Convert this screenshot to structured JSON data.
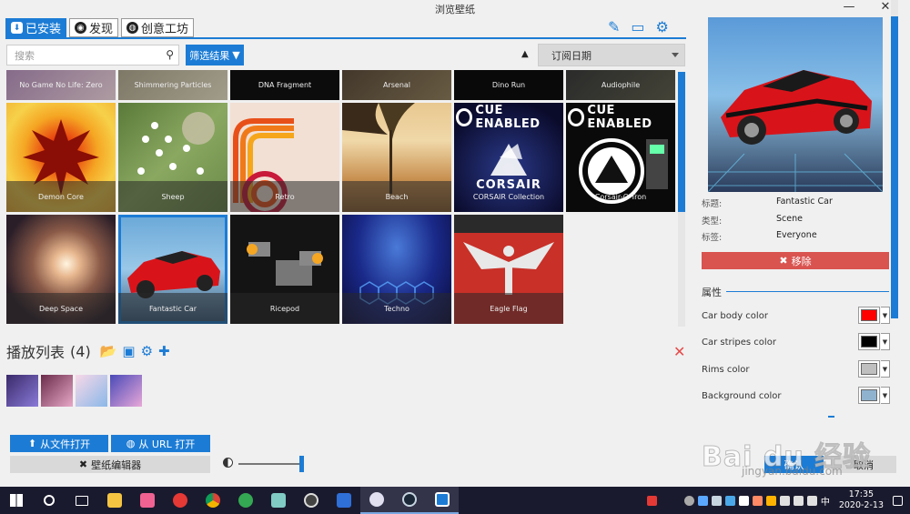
{
  "window": {
    "title": "浏览壁纸",
    "minimize": "—",
    "close": "✕"
  },
  "tabs": [
    {
      "label": "已安装",
      "icon": "download-icon",
      "active": true
    },
    {
      "label": "发现",
      "icon": "compass-icon",
      "active": false
    },
    {
      "label": "创意工坊",
      "icon": "steam-icon",
      "active": false
    }
  ],
  "toolbar_icons": [
    "brush-icon",
    "monitor-icon",
    "gear-icon"
  ],
  "search": {
    "placeholder": "搜索",
    "value": ""
  },
  "filter": {
    "label": "筛选结果"
  },
  "sort": {
    "value": "订阅日期"
  },
  "grid": {
    "row0": [
      "No Game No Life: Zero",
      "Shimmering Particles",
      "DNA Fragment",
      "Arsenal",
      "Dino Run",
      "Audiophile"
    ],
    "row1": [
      "Demon Core",
      "Sheep",
      "Retro",
      "Beach",
      "CORSAIR Collection",
      "Corsair-O-Tron"
    ],
    "row2": [
      "Deep Space",
      "Fantastic Car",
      "Ricepod",
      "Techno",
      "Eagle Flag"
    ],
    "cue_label": "CUE ENABLED",
    "corsair_label": "CORSAIR",
    "selected": "Fantastic Car"
  },
  "playlist": {
    "title": "播放列表",
    "count": "(4)"
  },
  "buttons": {
    "open_file": "从文件打开",
    "open_url": "从 URL 打开",
    "editor": "壁纸编辑器",
    "ok": "确认",
    "cancel": "取消"
  },
  "details": {
    "title_label": "标题:",
    "title_value": "Fantastic Car",
    "type_label": "类型:",
    "type_value": "Scene",
    "tags_label": "标签:",
    "tags_value": "Everyone",
    "remove": "移除"
  },
  "properties": {
    "label": "属性",
    "items": [
      {
        "name": "Car body color",
        "color": "#ff0000"
      },
      {
        "name": "Car stripes color",
        "color": "#000000"
      },
      {
        "name": "Rims color",
        "color": "#bfbfbf"
      },
      {
        "name": "Background color",
        "color": "#8fb3cf"
      }
    ]
  },
  "watermark": {
    "text": "Bai du 经验",
    "url": "jingyan.baidu.com"
  },
  "taskbar": {
    "time": "17:35",
    "date": "2020-2-13",
    "ime": "中",
    "apps": [
      "windows-icon",
      "cortana-icon",
      "task-view-icon",
      "file-explorer-icon",
      "bilibili-icon",
      "netease-music-icon",
      "chrome-icon",
      "edge-icon",
      "notepad-icon",
      "obs-icon",
      "wps-icon",
      "wallpaper-engine-icon",
      "steam-icon",
      "wallpaper-engine-active-icon"
    ]
  },
  "colors": {
    "accent": "#1c7cd5",
    "danger": "#d9534f"
  }
}
